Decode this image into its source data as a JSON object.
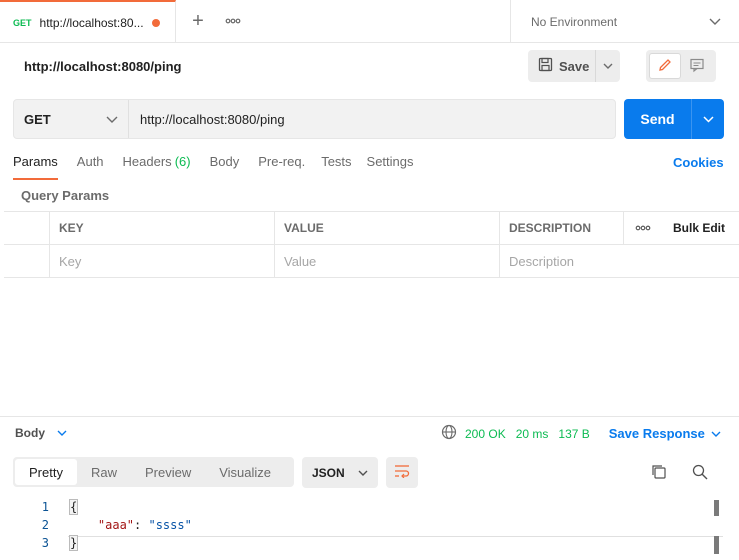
{
  "tab": {
    "method": "GET",
    "title": "http://localhost:80...",
    "unsaved_color": "#f26b3a"
  },
  "environment": {
    "selected": "No Environment"
  },
  "request": {
    "name": "http://localhost:8080/ping",
    "save_label": "Save",
    "method": "GET",
    "url": "http://localhost:8080/ping",
    "send_label": "Send"
  },
  "request_tabs": [
    {
      "label": "Params"
    },
    {
      "label": "Auth"
    },
    {
      "label": "Headers",
      "count": "(6)"
    },
    {
      "label": "Body"
    },
    {
      "label": "Pre-req."
    },
    {
      "label": "Tests"
    },
    {
      "label": "Settings"
    }
  ],
  "cookies_label": "Cookies",
  "query_params": {
    "label": "Query Params",
    "headers": {
      "key": "KEY",
      "value": "VALUE",
      "description": "DESCRIPTION",
      "bulk_edit": "Bulk Edit"
    },
    "placeholders": {
      "key": "Key",
      "value": "Value",
      "description": "Description"
    }
  },
  "response": {
    "body_label": "Body",
    "status": "200 OK",
    "time": "20 ms",
    "size": "137 B",
    "save_response": "Save Response",
    "view_modes": [
      "Pretty",
      "Raw",
      "Preview",
      "Visualize"
    ],
    "format": "JSON",
    "code_lines": [
      {
        "num": "1",
        "text": "{"
      },
      {
        "num": "2",
        "key": "\"aaa\"",
        "sep": ": ",
        "value": "\"ssss\""
      },
      {
        "num": "3",
        "text": "}"
      }
    ]
  },
  "colors": {
    "accent": "#097bed",
    "success": "#0cbb52",
    "active_tab": "#f26b3a"
  }
}
